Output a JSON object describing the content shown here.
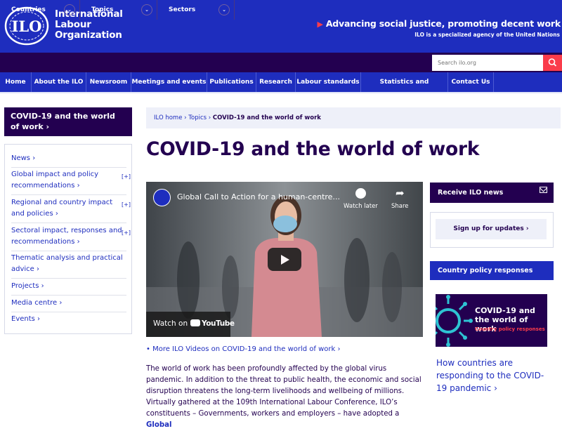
{
  "header": {
    "org_name": [
      "International",
      "Labour",
      "Organization"
    ],
    "tagline": "Advancing social justice, promoting decent work",
    "subtagline": "ILO is a specialized agency of the United Nations",
    "logo_text": "ILO"
  },
  "dropdowns": [
    {
      "label": "Countries"
    },
    {
      "label": "Topics"
    },
    {
      "label": "Sectors"
    }
  ],
  "search": {
    "placeholder": "Search ilo.org"
  },
  "nav": [
    "Home",
    "About the ILO",
    "Newsroom",
    "Meetings and events",
    "Publications",
    "Research",
    "Labour standards",
    "Statistics and databases",
    "Contact Us"
  ],
  "sidebar": {
    "title": "COVID-19 and the world of work ›",
    "items": [
      {
        "label": "News ›",
        "expand": ""
      },
      {
        "label": "Global impact and policy recommendations ›",
        "expand": "[+]"
      },
      {
        "label": "Regional and country impact and policies ›",
        "expand": "[+]"
      },
      {
        "label": "Sectoral impact, responses and recommendations ›",
        "expand": "[+]"
      },
      {
        "label": "Thematic analysis and practical advice ›",
        "expand": ""
      },
      {
        "label": "Projects ›",
        "expand": ""
      },
      {
        "label": "Media centre ›",
        "expand": ""
      },
      {
        "label": "Events ›",
        "expand": ""
      }
    ]
  },
  "breadcrumb": {
    "home": "ILO home",
    "sep": "›",
    "topics": "Topics",
    "current": "COVID-19 and the world of work"
  },
  "page_title": "COVID-19 and the world of work",
  "video": {
    "title": "Global Call to Action for a human-centre...",
    "watch_later": "Watch later",
    "share": "Share",
    "watch_on": "Watch on",
    "youtube": "YouTube"
  },
  "more_videos": "More ILO Videos on COVID-19 and the world of work ›",
  "body": {
    "p1": "The world of work has been profoundly affected by the global virus pandemic. In addition to the threat to public health, the economic and social disruption threatens the long-term livelihoods and wellbeing of millions.",
    "p2": "Virtually gathered at the 109th International Labour Conference, ILO’s constituents – Governments, workers and employers – have adopted a ",
    "p2_link": "Global"
  },
  "right": {
    "news_title": "Receive ILO news",
    "signup": "Sign up for updates",
    "signup_chevron": "›",
    "country_title": "Country policy responses",
    "img_title": "COVID-19 and the world of work",
    "img_sub": "Country policy responses",
    "link": "How countries are responding to the COVID-19 pandemic ›"
  },
  "colors": {
    "ilo_blue": "#1e2dbe",
    "ilo_navy": "#230050",
    "ilo_red": "#fa3c4b",
    "ilo_cyan": "#2ec3d3"
  }
}
